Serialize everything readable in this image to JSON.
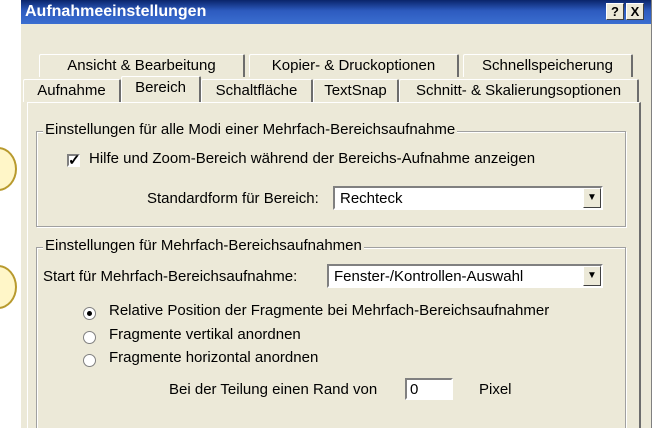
{
  "window": {
    "title": "Aufnahmeeinstellungen",
    "help_symbol": "?",
    "close_symbol": "X"
  },
  "tabs": {
    "row1": [
      "Ansicht & Bearbeitung",
      "Kopier- & Druckoptionen",
      "Schnellspeicherung"
    ],
    "row2": [
      "Aufnahme",
      "Bereich",
      "Schaltfläche",
      "TextSnap",
      "Schnitt- & Skalierungsoptionen"
    ],
    "active": "Bereich"
  },
  "group_all_modes": {
    "title": "Einstellungen für alle Modi einer Mehrfach-Bereichsaufnahme",
    "checkbox_label": "Hilfe und Zoom-Bereich während der Bereichs-Aufnahme anzeigen",
    "checkbox_checked": true,
    "shape_label": "Standardform für Bereich:",
    "shape_value": "Rechteck"
  },
  "group_multi": {
    "title": "Einstellungen für Mehrfach-Bereichsaufnahmen",
    "start_label": "Start für Mehrfach-Bereichsaufnahme:",
    "start_value": "Fenster-/Kontrollen-Auswahl",
    "radio_options": [
      "Relative Position der Fragmente bei Mehrfach-Bereichsaufnahmer",
      "Fragmente vertikal anordnen",
      "Fragmente horizontal anordnen"
    ],
    "radio_selected": 0,
    "margin_label": "Bei der Teilung einen Rand von",
    "margin_value": "0",
    "margin_unit": "Pixel"
  },
  "colors": {
    "titlebar": "#0a246a",
    "dialog_bg": "#ece9d8",
    "callout": "#fff6c8"
  }
}
